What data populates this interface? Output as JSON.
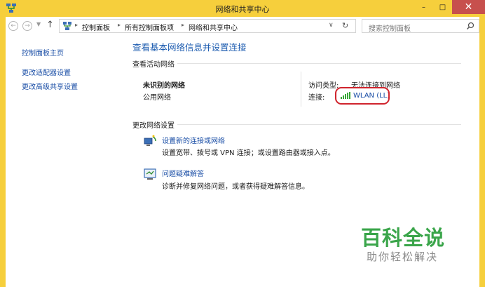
{
  "window": {
    "title": "网络和共享中心",
    "controls": {
      "minimize": "–",
      "maximize": "□",
      "close": "✕"
    }
  },
  "address_bar": {
    "breadcrumbs": [
      "控制面板",
      "所有控制面板项",
      "网络和共享中心"
    ],
    "search_placeholder": "搜索控制面板"
  },
  "sidebar": {
    "items": [
      {
        "label": "控制面板主页"
      },
      {
        "label": "更改适配器设置"
      },
      {
        "label": "更改高级共享设置"
      }
    ]
  },
  "main": {
    "heading": "查看基本网络信息并设置连接",
    "active_networks_label": "查看活动网络",
    "network": {
      "name": "未识别的网络",
      "type": "公用网络",
      "access_type_label": "访问类型:",
      "access_type_value": "无法连接到网络",
      "connection_label": "连接:",
      "connection_value": "WLAN (LL)"
    },
    "change_settings_label": "更改网络设置",
    "tasks": [
      {
        "title": "设置新的连接或网络",
        "desc": "设置宽带、拨号或 VPN 连接；或设置路由器或接入点。"
      },
      {
        "title": "问题疑难解答",
        "desc": "诊断并修复网络问题，或者获得疑难解答信息。"
      }
    ]
  },
  "watermark": {
    "main": "百科全说",
    "sub": "助你轻松解决"
  },
  "colors": {
    "titlebar": "#f6cf3c",
    "link": "#1a4ea6",
    "heading": "#1d5cb0",
    "highlight": "#d0242d",
    "watermark_green": "#3aa54a",
    "close_button": "#c7504d"
  }
}
